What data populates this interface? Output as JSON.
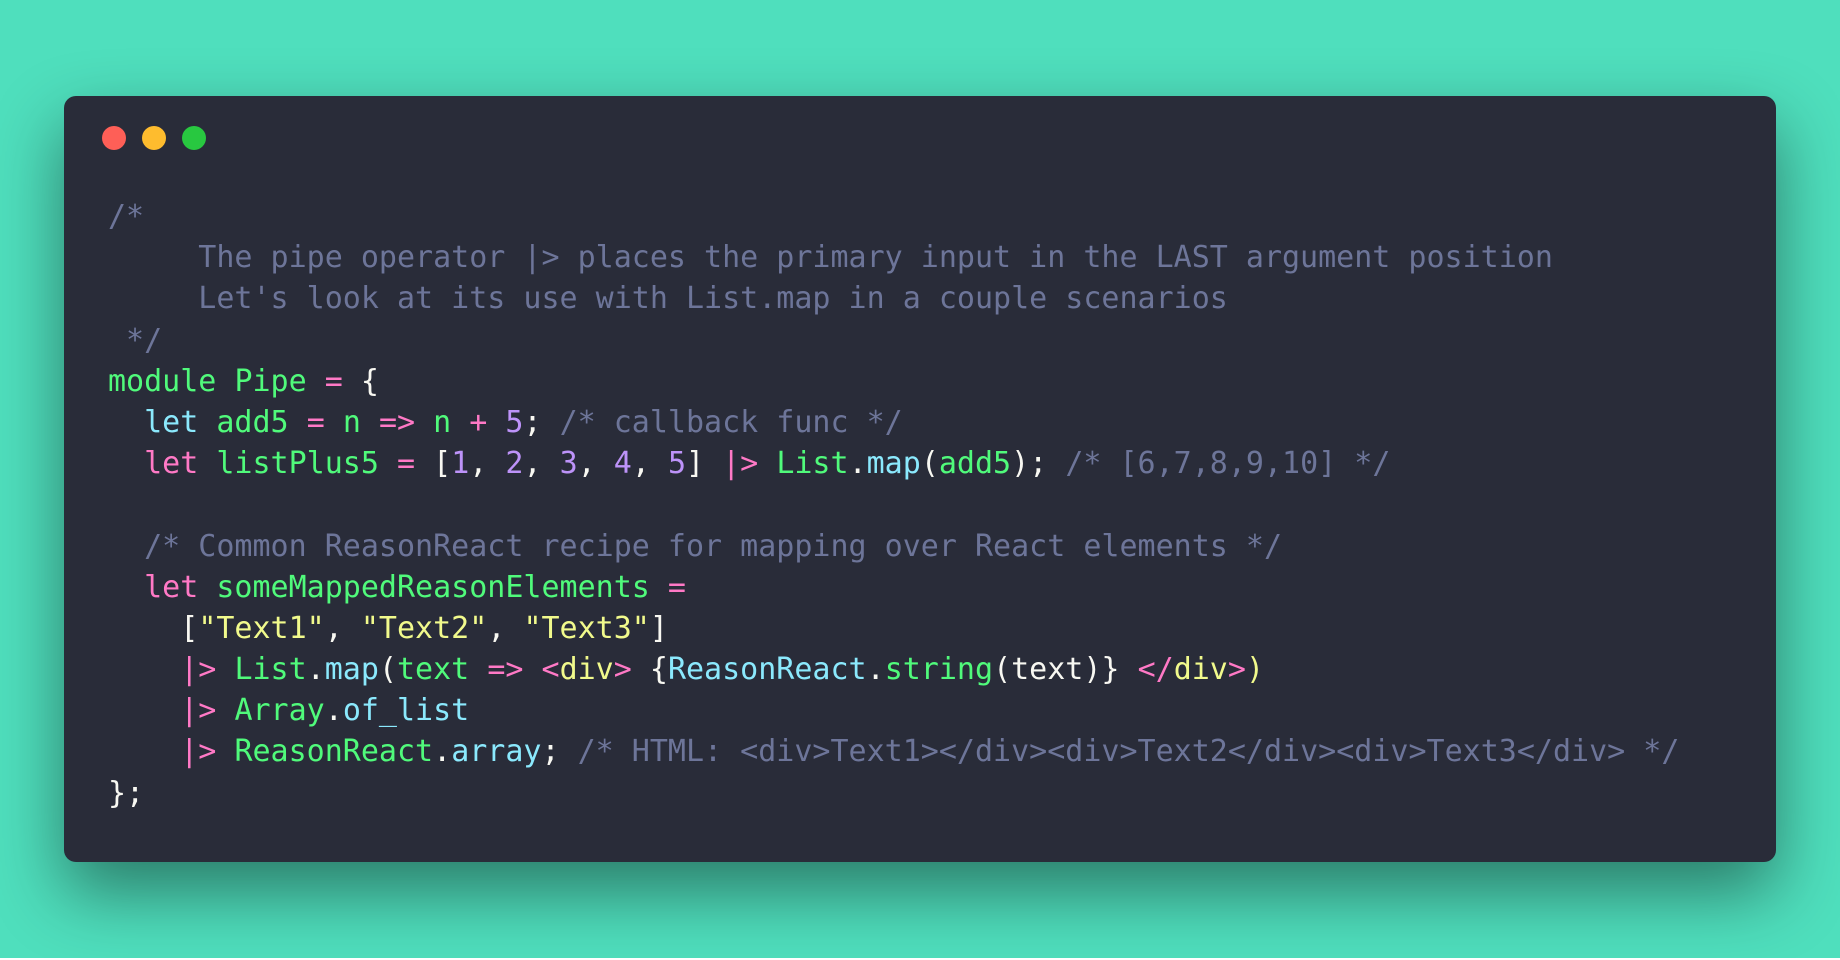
{
  "window": {
    "buttons": [
      "close",
      "minimize",
      "maximize"
    ],
    "colors": {
      "close": "#fe5f57",
      "minimize": "#febc2e",
      "maximize": "#28c840"
    }
  },
  "code_lines": [
    [
      [
        "comment",
        "/*"
      ]
    ],
    [
      [
        "comment",
        "     The pipe operator |> places the primary input in the LAST argument position"
      ]
    ],
    [
      [
        "comment",
        "     Let's look at its use with List.map in a couple scenarios"
      ]
    ],
    [
      [
        "comment",
        " */"
      ]
    ],
    [
      [
        "ident",
        "module"
      ],
      [
        "plain",
        " "
      ],
      [
        "module",
        "Pipe"
      ],
      [
        "plain",
        " "
      ],
      [
        "op",
        "="
      ],
      [
        "plain",
        " "
      ],
      [
        "punct",
        "{"
      ]
    ],
    [
      [
        "plain",
        "  "
      ],
      [
        "func",
        "let"
      ],
      [
        "plain",
        " "
      ],
      [
        "ident",
        "add5"
      ],
      [
        "plain",
        " "
      ],
      [
        "op",
        "="
      ],
      [
        "plain",
        " "
      ],
      [
        "ident",
        "n"
      ],
      [
        "plain",
        " "
      ],
      [
        "op",
        "=>"
      ],
      [
        "plain",
        " "
      ],
      [
        "ident",
        "n"
      ],
      [
        "plain",
        " "
      ],
      [
        "op",
        "+"
      ],
      [
        "plain",
        " "
      ],
      [
        "number",
        "5"
      ],
      [
        "punct",
        ";"
      ],
      [
        "plain",
        " "
      ],
      [
        "comment",
        "/* callback func */"
      ]
    ],
    [
      [
        "plain",
        "  "
      ],
      [
        "keyword",
        "let"
      ],
      [
        "plain",
        " "
      ],
      [
        "ident",
        "listPlus5"
      ],
      [
        "plain",
        " "
      ],
      [
        "op",
        "="
      ],
      [
        "plain",
        " "
      ],
      [
        "punct",
        "["
      ],
      [
        "number",
        "1"
      ],
      [
        "punct",
        ", "
      ],
      [
        "number",
        "2"
      ],
      [
        "punct",
        ", "
      ],
      [
        "number",
        "3"
      ],
      [
        "punct",
        ", "
      ],
      [
        "number",
        "4"
      ],
      [
        "punct",
        ", "
      ],
      [
        "number",
        "5"
      ],
      [
        "punct",
        "]"
      ],
      [
        "plain",
        " "
      ],
      [
        "op",
        "|>"
      ],
      [
        "plain",
        " "
      ],
      [
        "module",
        "List"
      ],
      [
        "punct",
        "."
      ],
      [
        "func",
        "map"
      ],
      [
        "punct",
        "("
      ],
      [
        "ident",
        "add5"
      ],
      [
        "punct",
        ");"
      ],
      [
        "plain",
        " "
      ],
      [
        "comment",
        "/* [6,7,8,9,10] */"
      ]
    ],
    [
      [
        "plain",
        ""
      ]
    ],
    [
      [
        "plain",
        "  "
      ],
      [
        "comment",
        "/* Common ReasonReact recipe for mapping over React elements */"
      ]
    ],
    [
      [
        "plain",
        "  "
      ],
      [
        "keyword",
        "let"
      ],
      [
        "plain",
        " "
      ],
      [
        "ident",
        "someMappedReasonElements"
      ],
      [
        "plain",
        " "
      ],
      [
        "op",
        "="
      ]
    ],
    [
      [
        "plain",
        "    "
      ],
      [
        "punct",
        "["
      ],
      [
        "string",
        "\"Text1\""
      ],
      [
        "punct",
        ", "
      ],
      [
        "string",
        "\"Text2\""
      ],
      [
        "punct",
        ", "
      ],
      [
        "string",
        "\"Text3\""
      ],
      [
        "punct",
        "]"
      ]
    ],
    [
      [
        "plain",
        "    "
      ],
      [
        "op",
        "|>"
      ],
      [
        "plain",
        " "
      ],
      [
        "module",
        "List"
      ],
      [
        "punct",
        "."
      ],
      [
        "func",
        "map"
      ],
      [
        "punct",
        "("
      ],
      [
        "ident",
        "text"
      ],
      [
        "plain",
        " "
      ],
      [
        "op",
        "=>"
      ],
      [
        "plain",
        " "
      ],
      [
        "op",
        "<"
      ],
      [
        "string",
        "div"
      ],
      [
        "op",
        ">"
      ],
      [
        "plain",
        " "
      ],
      [
        "punct",
        "{"
      ],
      [
        "func",
        "ReasonReact"
      ],
      [
        "punct",
        "."
      ],
      [
        "ident",
        "string"
      ],
      [
        "punct",
        "("
      ],
      [
        "plain",
        "text"
      ],
      [
        "punct",
        ")}"
      ],
      [
        "plain",
        " "
      ],
      [
        "op",
        "</"
      ],
      [
        "string",
        "div"
      ],
      [
        "op",
        ">"
      ],
      [
        "string",
        ")"
      ]
    ],
    [
      [
        "plain",
        "    "
      ],
      [
        "op",
        "|>"
      ],
      [
        "plain",
        " "
      ],
      [
        "module",
        "Array"
      ],
      [
        "punct",
        "."
      ],
      [
        "func",
        "of_list"
      ]
    ],
    [
      [
        "plain",
        "    "
      ],
      [
        "op",
        "|>"
      ],
      [
        "plain",
        " "
      ],
      [
        "module",
        "ReasonReact"
      ],
      [
        "punct",
        "."
      ],
      [
        "func",
        "array"
      ],
      [
        "punct",
        ";"
      ],
      [
        "plain",
        " "
      ],
      [
        "comment",
        "/* HTML: <div>Text1></div><div>Text2</div><div>Text3</div> */"
      ]
    ],
    [
      [
        "punct",
        "};"
      ]
    ]
  ]
}
